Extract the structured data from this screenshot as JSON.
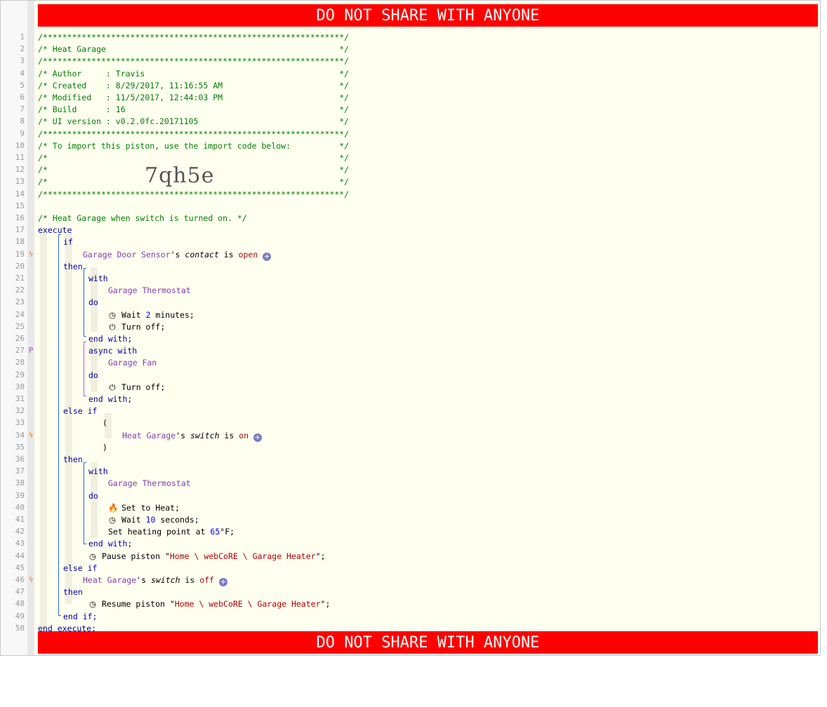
{
  "banner": {
    "top": "DO NOT SHARE WITH ANYONE",
    "bottom": "DO NOT SHARE WITH ANYONE"
  },
  "import_code": "7qh5e",
  "lines": [
    {
      "n": "1",
      "t": "/**************************************************************/"
    },
    {
      "n": "2",
      "t": "/* Heat Garage                                                */"
    },
    {
      "n": "3",
      "t": "/**************************************************************/"
    },
    {
      "n": "4",
      "t": "/* Author     : Travis                                        */"
    },
    {
      "n": "5",
      "t": "/* Created    : 8/29/2017, 11:16:55 AM                        */"
    },
    {
      "n": "6",
      "t": "/* Modified   : 11/5/2017, 12:44:03 PM                        */"
    },
    {
      "n": "7",
      "t": "/* Build      : 16                                            */"
    },
    {
      "n": "8",
      "t": "/* UI version : v0.2.0fc.20171105                             */"
    },
    {
      "n": "9",
      "t": "/**************************************************************/"
    },
    {
      "n": "10",
      "t": "/* To import this piston, use the import code below:          */"
    },
    {
      "n": "11",
      "t": "/*                                                            */"
    },
    {
      "n": "12",
      "t": "/*                                                            */"
    },
    {
      "n": "13",
      "t": "/*                                                            */"
    },
    {
      "n": "14",
      "t": "/**************************************************************/"
    },
    {
      "n": "15",
      "t": ""
    },
    {
      "n": "16",
      "t": "/* Heat Garage when switch is turned on. */"
    },
    {
      "n": "17",
      "t": "execute"
    },
    {
      "n": "18",
      "t": "if"
    },
    {
      "n": "19",
      "dev": "Garage Door Sensor",
      "q": "'s ",
      "attr": "contact",
      "op": " is ",
      "val": "open"
    },
    {
      "n": "20",
      "t": "then"
    },
    {
      "n": "21",
      "t": "with"
    },
    {
      "n": "22",
      "t": "Garage Thermostat"
    },
    {
      "n": "23",
      "t": "do"
    },
    {
      "n": "24",
      "a": "Wait ",
      "num": "2",
      "b": " minutes;"
    },
    {
      "n": "25",
      "t": "Turn off;"
    },
    {
      "n": "26",
      "t": "end with;"
    },
    {
      "n": "27",
      "t": "async with"
    },
    {
      "n": "28",
      "t": "Garage Fan"
    },
    {
      "n": "29",
      "t": "do"
    },
    {
      "n": "30",
      "t": "Turn off;"
    },
    {
      "n": "31",
      "t": "end with;"
    },
    {
      "n": "32",
      "t": "else if"
    },
    {
      "n": "33",
      "t": "("
    },
    {
      "n": "34",
      "dev": "Heat Garage",
      "q": "'s ",
      "attr": "switch",
      "op": " is ",
      "val": "on"
    },
    {
      "n": "35",
      "t": ")"
    },
    {
      "n": "36",
      "t": "then"
    },
    {
      "n": "37",
      "t": "with"
    },
    {
      "n": "38",
      "t": "Garage Thermostat"
    },
    {
      "n": "39",
      "t": "do"
    },
    {
      "n": "40",
      "t": "Set to Heat;"
    },
    {
      "n": "41",
      "a": "Wait ",
      "num": "10",
      "b": " seconds;"
    },
    {
      "n": "42",
      "a": "Set heating point at ",
      "num": "65",
      "b": "°F;"
    },
    {
      "n": "43",
      "t": "end with;"
    },
    {
      "n": "44",
      "a": "Pause piston \"",
      "str": "Home \\ webCoRE \\ Garage Heater",
      "b": "\";"
    },
    {
      "n": "45",
      "t": "else if"
    },
    {
      "n": "46",
      "dev": "Heat Garage",
      "q": "'s ",
      "attr": "switch",
      "op": " is ",
      "val": "off"
    },
    {
      "n": "47",
      "t": "then"
    },
    {
      "n": "48",
      "a": "Resume piston \"",
      "str": "Home \\ webCoRE \\ Garage Heater",
      "b": "\";"
    },
    {
      "n": "49",
      "t": "end if;"
    },
    {
      "n": "50",
      "t": "end execute;"
    }
  ],
  "gutter_marks": {
    "19": "ϟ",
    "27": "P",
    "34": "ϟ",
    "46": "ϟ"
  },
  "icons": {
    "plus": "+",
    "clock": "◷",
    "power": "⏻",
    "flame": "🔥"
  }
}
